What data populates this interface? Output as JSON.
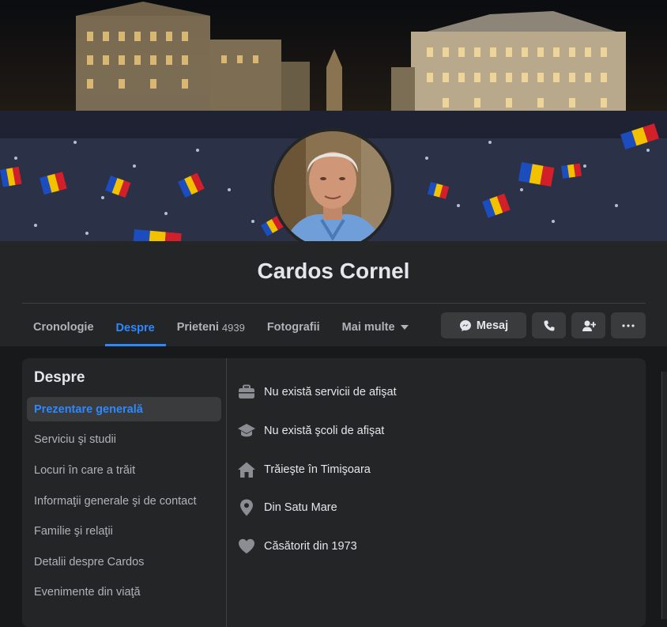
{
  "profile": {
    "name": "Cardos Cornel"
  },
  "tabs": [
    {
      "label": "Cronologie"
    },
    {
      "label": "Despre"
    },
    {
      "label": "Prieteni",
      "count": "4939"
    },
    {
      "label": "Fotografii"
    },
    {
      "label": "Mai multe"
    }
  ],
  "actions": {
    "message_label": "Mesaj"
  },
  "about": {
    "title": "Despre",
    "nav": [
      {
        "label": "Prezentare generală"
      },
      {
        "label": "Serviciu şi studii"
      },
      {
        "label": "Locuri în care a trăit"
      },
      {
        "label": "Informaţii generale şi de contact"
      },
      {
        "label": "Familie şi relaţii"
      },
      {
        "label": "Detalii despre Cardos"
      },
      {
        "label": "Evenimente din viaţă"
      }
    ],
    "items": [
      {
        "text": "Nu există servicii de afişat",
        "icon": "briefcase-icon"
      },
      {
        "text": "Nu există şcoli de afişat",
        "icon": "graduation-cap-icon"
      },
      {
        "text": "Trăieşte în Timişoara",
        "icon": "home-icon"
      },
      {
        "text": "Din Satu Mare",
        "icon": "location-pin-icon"
      },
      {
        "text": "Căsătorit din 1973",
        "icon": "heart-icon"
      }
    ]
  },
  "colors": {
    "accent": "#2d88ff",
    "background": "#18191a",
    "surface": "#242526"
  }
}
